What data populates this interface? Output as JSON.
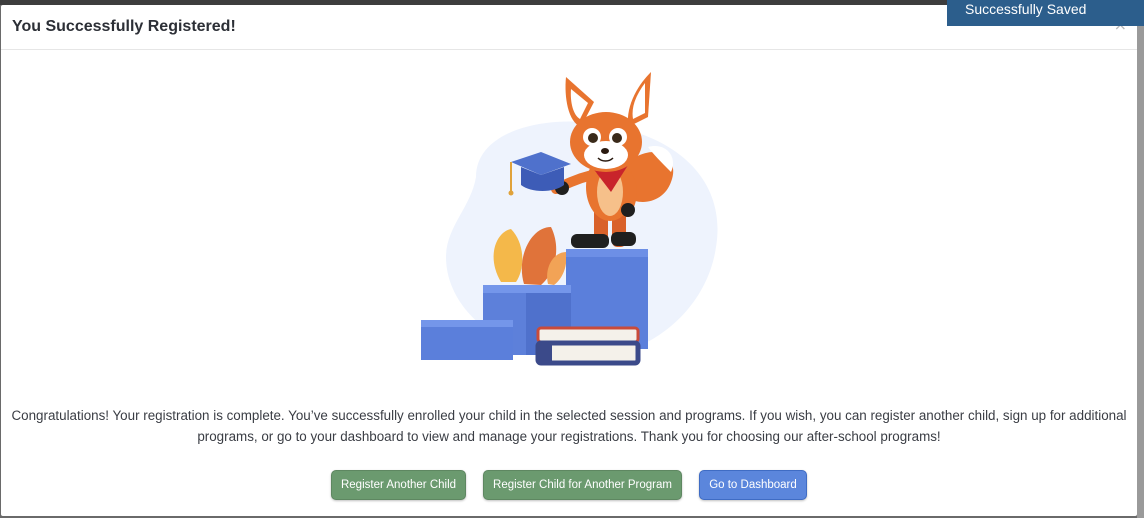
{
  "modal": {
    "title": "You Successfully Registered!",
    "close_label": "×",
    "message": "Congratulations! Your registration is complete. You’ve successfully enrolled your child in the selected session and programs. If you wish, you can register another child, sign up for additional programs, or go to your dashboard to view and manage your registrations. Thank you for choosing our after-school programs!",
    "illustration_icon": "fox-graduate-illustration"
  },
  "toast": {
    "text": "Successfully Saved",
    "color": "#2c5e8c"
  },
  "actions": {
    "register_another_child": "Register Another Child",
    "register_another_program": "Register Child for Another Program",
    "go_to_dashboard": "Go to Dashboard"
  },
  "colors": {
    "green_button": "#6b9a6f",
    "blue_button": "#5b86dc"
  }
}
